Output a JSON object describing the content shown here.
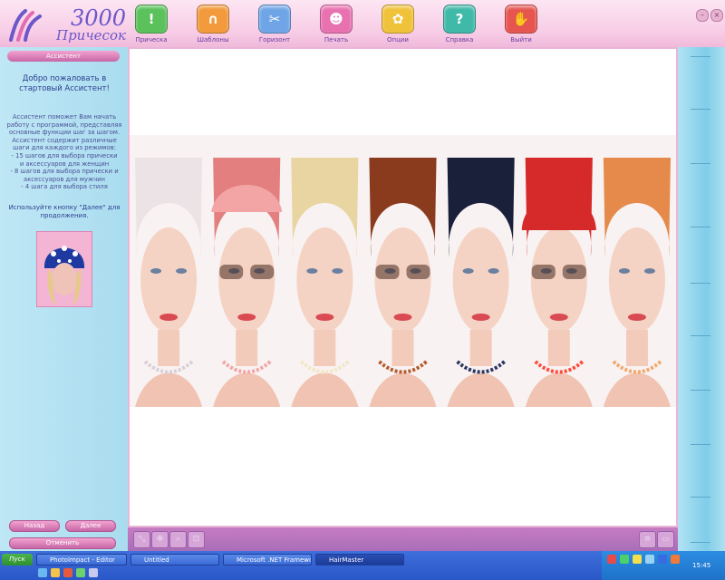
{
  "app": {
    "logo_number": "3000",
    "logo_word": "Причесок"
  },
  "toolbar": [
    {
      "label": "Прическа",
      "icon": "exclamation-icon",
      "color": "#5bc15b"
    },
    {
      "label": "Шаблоны",
      "icon": "magnet-icon",
      "color": "#f29a3c"
    },
    {
      "label": "Горизонт",
      "icon": "scissors-icon",
      "color": "#6fa5e6"
    },
    {
      "label": "Печать",
      "icon": "user-icon",
      "color": "#e872b0"
    },
    {
      "label": "Опции",
      "icon": "gear-icon",
      "color": "#f0c23a"
    },
    {
      "label": "Справка",
      "icon": "question-icon",
      "color": "#3fb9a8"
    },
    {
      "label": "Выйти",
      "icon": "hand-icon",
      "color": "#e6554f"
    }
  ],
  "window_controls": {
    "minimize": "–",
    "close": "×"
  },
  "assistant": {
    "title": "Ассистент",
    "welcome": "Добро пожаловать в стартовый Ассистент!",
    "body": "Ассистент поможет Вам начать\nработу с программой, представляя\nосновные функции шаг за шагом.\nАссистент содержит различные\nшаги для каждого из режимов:\n- 15 шагов для выбора прически\nи аксессуаров для женщин\n- 8 шагов для выбора прически и\nаксессуаров для мужчин\n- 4 шага для выбора стиля",
    "continue_text": "Используйте кнопку \"Далее\" для продолжения.",
    "back_button": "Назад",
    "next_button": "Далее",
    "cancel_button": "Отменить"
  },
  "preview_bar": {
    "tools": [
      "move-icon",
      "pan-icon",
      "zoom-icon",
      "fit-icon"
    ],
    "views": [
      "list-view-icon",
      "grid-view-icon"
    ]
  },
  "preview_models": [
    {
      "hair": "#ece3e6",
      "accent": "#d9cfd6",
      "item": "none"
    },
    {
      "hair": "#e37f7f",
      "accent": "#f3a4a4",
      "item": "bandana"
    },
    {
      "hair": "#e9d5a1",
      "accent": "#f2e6c4",
      "item": "none"
    },
    {
      "hair": "#8a3a1d",
      "accent": "#b55b2b",
      "item": "sunglasses"
    },
    {
      "hair": "#1a1f3a",
      "accent": "#2b3560",
      "item": "none"
    },
    {
      "hair": "#d62a2a",
      "accent": "#ff4a3a",
      "item": "cap"
    },
    {
      "hair": "#e58a4a",
      "accent": "#f3a76b",
      "item": "none"
    }
  ],
  "taskbar": {
    "start": "Пуск",
    "tasks": [
      "PhotoImpact - Editor",
      "Untitled",
      "Microsoft .NET Framewo...",
      "HairMaster"
    ],
    "clock": "15:45"
  }
}
